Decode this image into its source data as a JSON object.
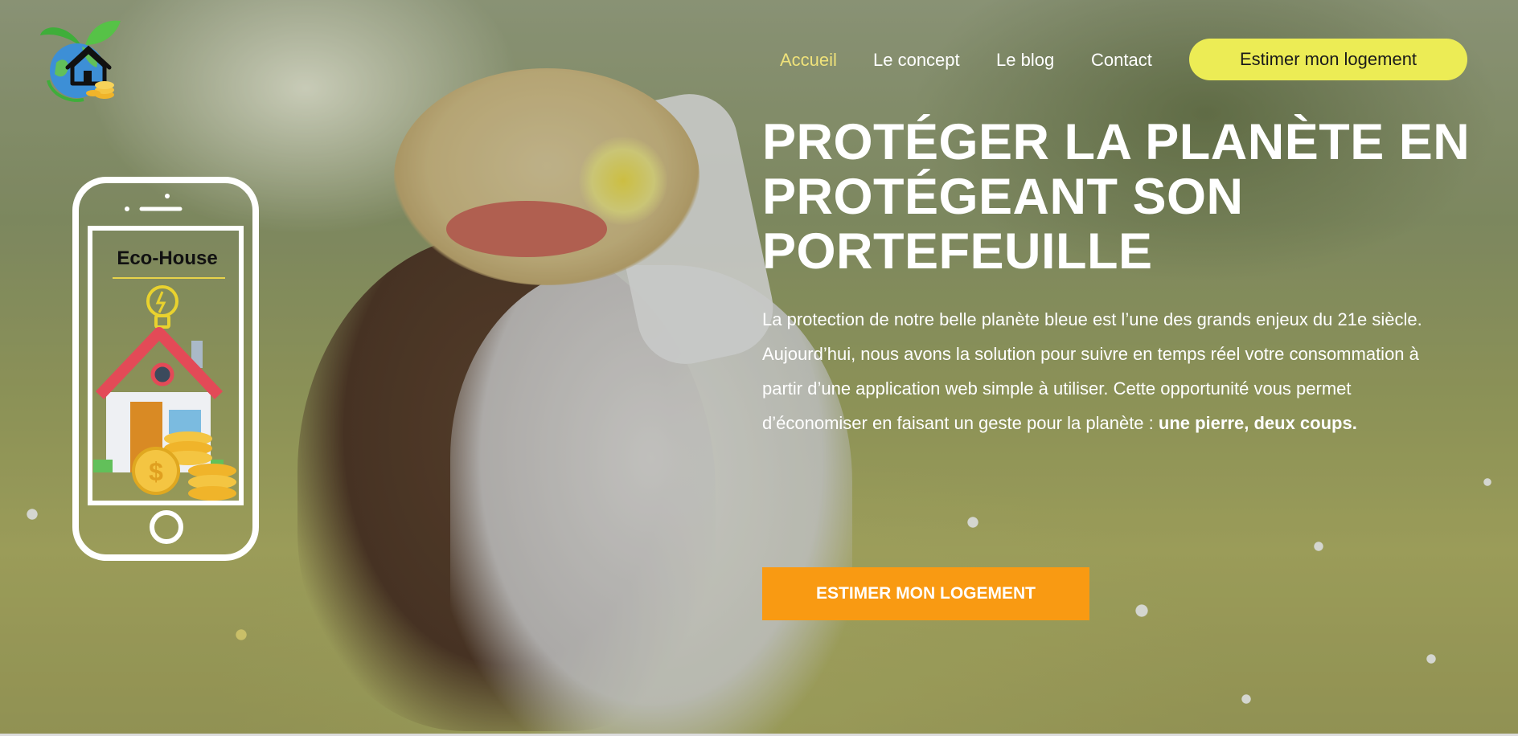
{
  "brand": {
    "logo_alt": "Eco-House logo",
    "app_name": "Eco-House"
  },
  "nav": {
    "items": [
      {
        "label": "Accueil",
        "active": true
      },
      {
        "label": "Le concept",
        "active": false
      },
      {
        "label": "Le blog",
        "active": false
      },
      {
        "label": "Contact",
        "active": false
      }
    ],
    "cta_label": "Estimer mon logement"
  },
  "hero": {
    "headline_lines": [
      "PROTÉGER LA PLANÈTE EN",
      "PROTÉGEANT SON",
      "PORTEFEUILLE"
    ],
    "paragraph_1": "La protection de notre belle planète bleue est l’une des grands enjeux du 21e siècle.",
    "paragraph_2": "Aujourd’hui, nous avons la solution pour suivre en temps réel votre consommation à partir d’une application web simple à utiliser. Cette opportunité vous permet d’économiser en faisant un geste pour la planète : ",
    "paragraph_2_bold": "une pierre, deux coups.",
    "cta_label": "ESTIMER MON LOGEMENT"
  },
  "icons": [
    "logo-house-globe-icon",
    "lightbulb-icon",
    "house-icon",
    "coins-icon",
    "smartphone-icon"
  ],
  "colors": {
    "nav_active": "#efe27a",
    "nav_cta_bg": "#ecec55",
    "hero_cta_bg": "#f99a12",
    "text": "#ffffff"
  }
}
